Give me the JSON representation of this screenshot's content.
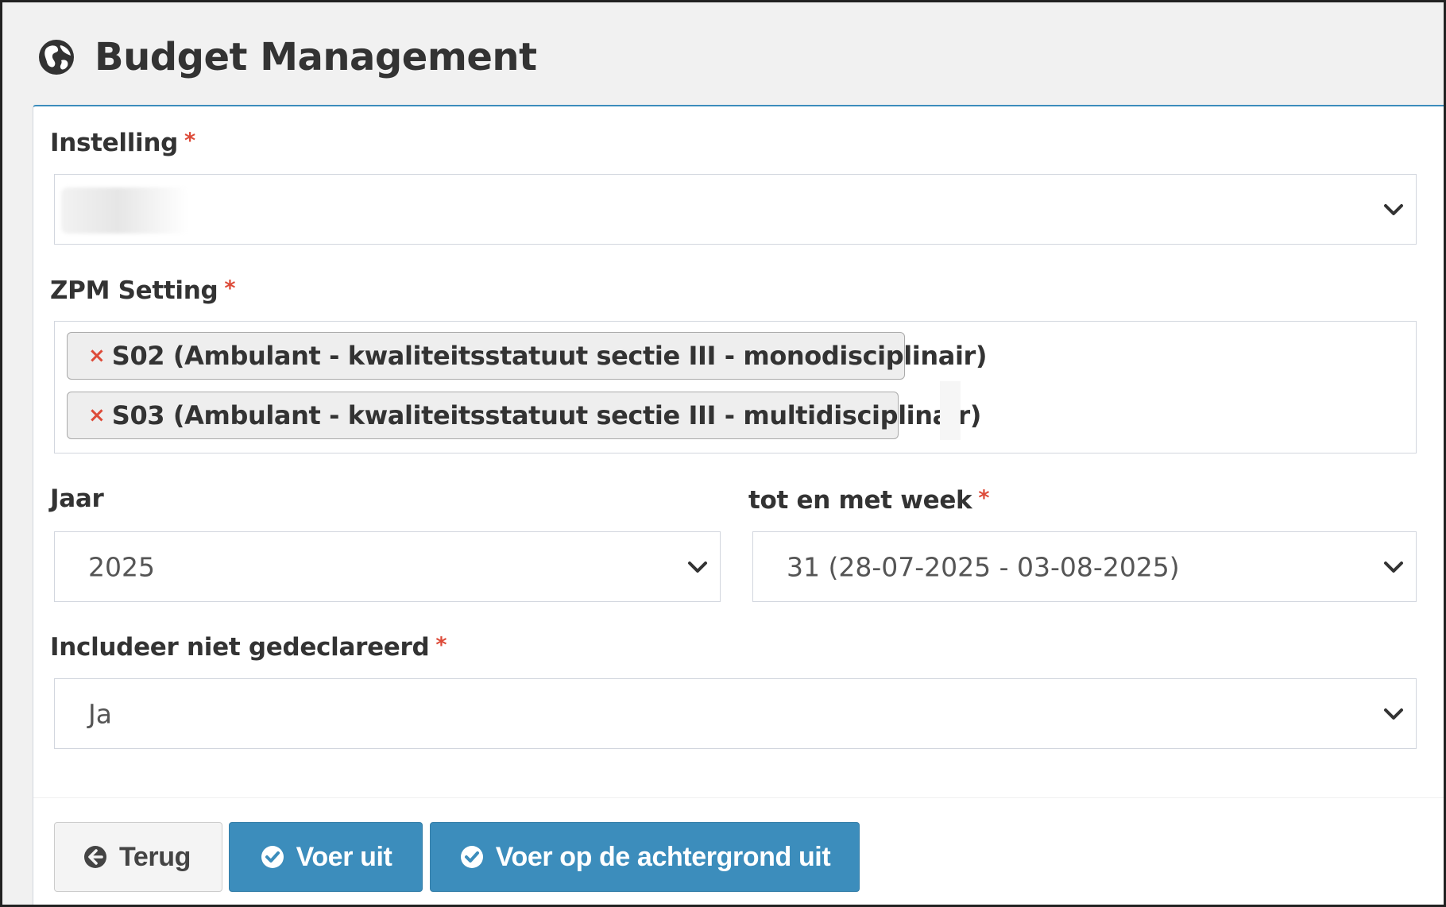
{
  "header": {
    "title": "Budget Management",
    "icon": "globe-icon"
  },
  "form": {
    "instelling": {
      "label": "Instelling",
      "required_mark": "*",
      "value": ""
    },
    "zpm_setting": {
      "label": "ZPM Setting",
      "required_mark": "*",
      "selected": [
        {
          "remove": "×",
          "label": "S02 (Ambulant - kwaliteitsstatuut sectie III - monodisciplinair)"
        },
        {
          "remove": "×",
          "label": "S03 (Ambulant - kwaliteitsstatuut sectie III - multidisciplinair)"
        }
      ]
    },
    "jaar": {
      "label": "Jaar",
      "value": "2025"
    },
    "tot_en_met_week": {
      "label": "tot en met week",
      "required_mark": "*",
      "value": "31 (28-07-2025 - 03-08-2025)"
    },
    "includeer_niet_gedeclareerd": {
      "label": "Includeer niet gedeclareerd",
      "required_mark": "*",
      "value": "Ja"
    }
  },
  "buttons": {
    "back": {
      "label": "Terug",
      "icon": "arrow-circle-left-icon"
    },
    "execute": {
      "label": "Voer uit",
      "icon": "check-circle-icon"
    },
    "execute_background": {
      "label": "Voer op de achtergrond uit",
      "icon": "check-circle-icon"
    }
  },
  "colors": {
    "primary": "#3c8dbc",
    "required": "#dd4b39",
    "panel_border": "#3c8dbc",
    "page_background": "#f1f1f1"
  }
}
